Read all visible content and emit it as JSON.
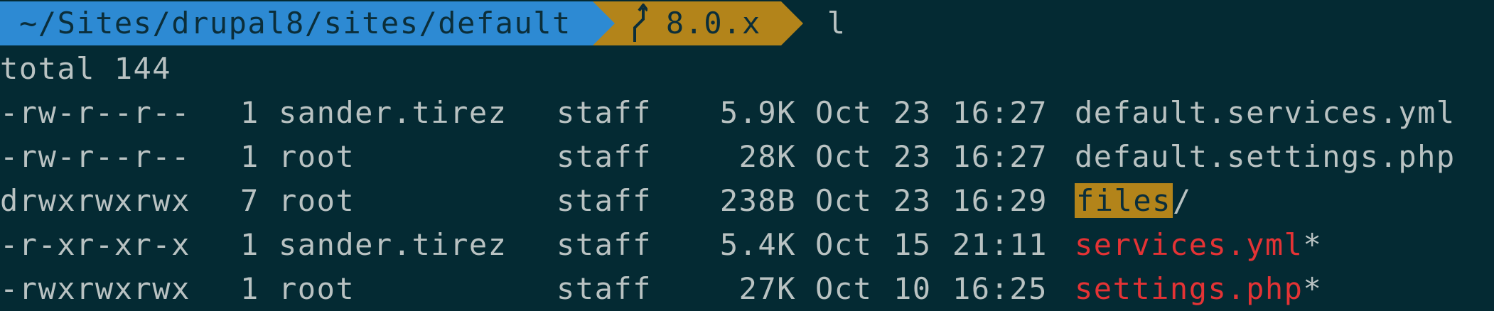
{
  "prompt": {
    "path": "~/Sites/drupal8/sites/default",
    "git_branch": "8.0.x",
    "command": "l",
    "colors": {
      "path_bg": "#2d8ad3",
      "git_bg": "#b3841a",
      "terminal_bg": "#042a33",
      "text": "#b9c2c2"
    }
  },
  "listing": {
    "total": "total 144",
    "rows": [
      {
        "perm": "-rw-r--r--",
        "links": "1",
        "owner": "sander.tirez",
        "group": "staff",
        "size": "5.9K",
        "month": "Oct",
        "day": "23",
        "time": "16:27",
        "name": "default.services.yml",
        "suffix": ""
      },
      {
        "perm": "-rw-r--r--",
        "links": "1",
        "owner": "root",
        "group": "staff",
        "size": "28K",
        "month": "Oct",
        "day": "23",
        "time": "16:27",
        "name": "default.settings.php",
        "suffix": ""
      },
      {
        "perm": "drwxrwxrwx",
        "links": "7",
        "owner": "root",
        "group": "staff",
        "size": "238B",
        "month": "Oct",
        "day": "23",
        "time": "16:29",
        "name": "files",
        "suffix": "/"
      },
      {
        "perm": "-r-xr-xr-x",
        "links": "1",
        "owner": "sander.tirez",
        "group": "staff",
        "size": "5.4K",
        "month": "Oct",
        "day": "15",
        "time": "21:11",
        "name": "services.yml",
        "suffix": "*"
      },
      {
        "perm": "-rwxrwxrwx",
        "links": "1",
        "owner": "root",
        "group": "staff",
        "size": "27K",
        "month": "Oct",
        "day": "10",
        "time": "16:25",
        "name": "settings.php",
        "suffix": "*"
      }
    ]
  }
}
